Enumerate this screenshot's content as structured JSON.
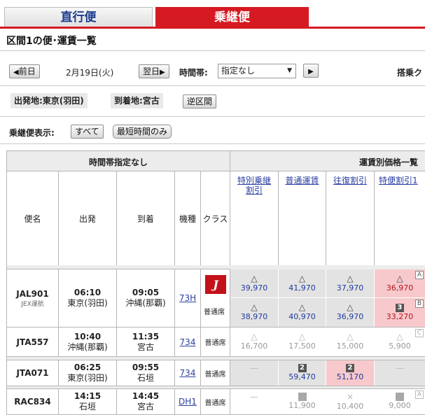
{
  "tabs": {
    "direct": "直行便",
    "transfer": "乗継便"
  },
  "section_title": "区間1の便･運賃一覧",
  "toolbar": {
    "prev_day": "前日",
    "date": "2月19日(火)",
    "next_day": "翌日",
    "time_label": "時間帯:",
    "time_select": "指定なし",
    "passenger_label": "搭乗ク"
  },
  "route": {
    "origin": "出発地:東京(羽田)",
    "destination": "到着地:宮古",
    "reverse_button": "逆区間"
  },
  "filter": {
    "label": "乗継便表示:",
    "all_button": "すべて",
    "shortest_button": "最短時間のみ"
  },
  "table": {
    "left_header": "時間帯指定なし",
    "right_header": "運賃別価格一覧",
    "columns": {
      "flight": "便名",
      "depart": "出発",
      "arrive": "到着",
      "aircraft": "機種",
      "class": "クラス"
    },
    "fare_types": [
      {
        "line1": "特別乗継",
        "line2": "割引"
      },
      {
        "line1": "普通運賃",
        "line2": ""
      },
      {
        "line1": "往復割引",
        "line2": ""
      },
      {
        "line1": "特便割引1",
        "line2": ""
      }
    ],
    "rows": [
      {
        "flight": "JAL901",
        "operator": "JEX運航",
        "dep_time": "06:10",
        "dep_port": "東京(羽田)",
        "arr_time": "09:05",
        "arr_port": "沖縄(那覇)",
        "aircraft": "73H",
        "class_logo": "J",
        "class": "普通席",
        "fares_a": [
          "39,970",
          "41,970",
          "37,970",
          "36,970"
        ],
        "fares_b": [
          "38,970",
          "40,970",
          "36,970",
          "33,270"
        ],
        "tag_a": "A",
        "tag_b": "B",
        "seats_b4": "3"
      },
      {
        "flight": "JTA557",
        "dep_time": "10:40",
        "dep_port": "沖縄(那覇)",
        "arr_time": "11:35",
        "arr_port": "宮古",
        "aircraft": "734",
        "class": "普通席",
        "fares": [
          "16,700",
          "17,500",
          "15,000",
          "5,900"
        ],
        "tag": "C"
      },
      {
        "flight": "JTA071",
        "dep_time": "06:25",
        "dep_port": "東京(羽田)",
        "arr_time": "09:55",
        "arr_port": "石垣",
        "aircraft": "734",
        "class": "普通席",
        "fares": [
          "",
          "59,470",
          "51,170",
          ""
        ],
        "seats": [
          "2",
          "2"
        ]
      },
      {
        "flight": "RAC834",
        "dep_time": "14:15",
        "dep_port": "石垣",
        "arr_time": "14:45",
        "arr_port": "宮古",
        "aircraft": "DH1",
        "class": "普通席",
        "fares": [
          "",
          "11,900",
          "10,400",
          "9,000"
        ],
        "tag": "A"
      }
    ]
  },
  "symbols": {
    "available": "△",
    "full": "×",
    "none": "—"
  },
  "colors": {
    "accent": "#d51a22",
    "link": "#2a3fa0",
    "highlight": "#f7c9cc"
  }
}
